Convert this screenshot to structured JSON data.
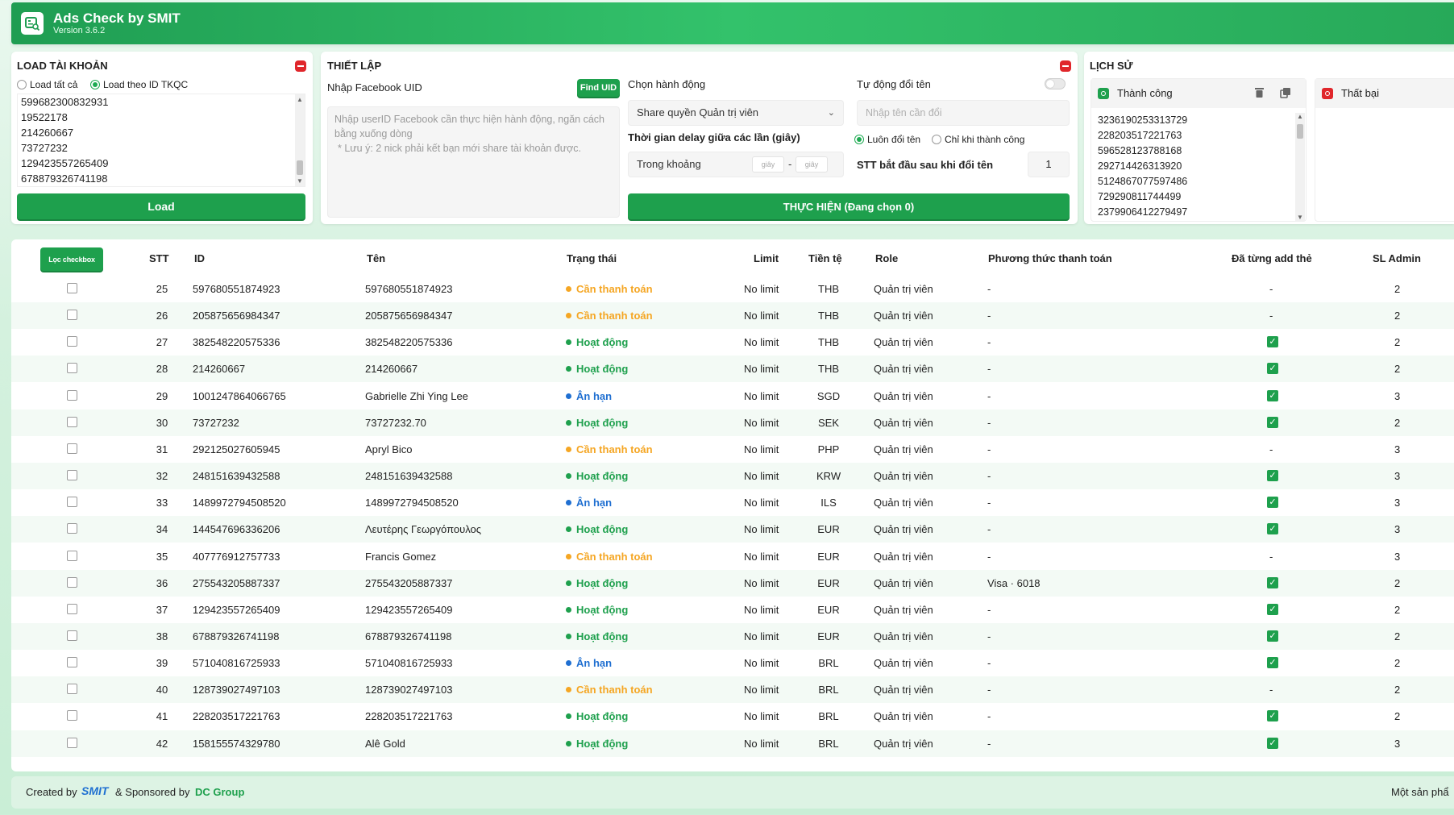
{
  "app": {
    "title": "Ads Check by SMIT",
    "version": "Version 3.6.2"
  },
  "load_panel": {
    "title": "LOAD TÀI KHOẢN",
    "radio_all": "Load tất cả",
    "radio_id": "Load theo ID TKQC",
    "ids": [
      "599682300832931",
      "19522178",
      "214260667",
      "73727232",
      "129423557265409",
      "678879326741198"
    ],
    "load_button": "Load"
  },
  "setup_panel": {
    "title": "THIẾT LẬP",
    "uid_label": "Nhập Facebook UID",
    "find_uid_button": "Find UID",
    "uid_placeholder": "Nhập userID Facebook cần thực hiện hành động, ngăn cách bằng xuống dòng",
    "uid_note": "* Lưu ý: 2 nick phải kết bạn mới share tài khoản được.",
    "action_label": "Chọn hành động",
    "action_value": "Share quyền Quản trị viên",
    "delay_label": "Thời gian delay giữa các lần (giây)",
    "delay_prefix": "Trong khoảng",
    "delay_from_placeholder": "giây",
    "delay_to_placeholder": "giây",
    "delay_dash": "-",
    "rename_label": "Tự động đổi tên",
    "rename_placeholder": "Nhập tên cần đổi",
    "rename_always": "Luôn đổi tên",
    "rename_success_only": "Chỉ khi thành công",
    "stt_label": "STT bắt đầu sau khi đổi tên",
    "stt_value": "1",
    "execute_button": "THỰC HIỆN (Đang chọn 0)"
  },
  "history_panel": {
    "title": "LỊCH SỬ",
    "success_label": "Thành công",
    "failed_label": "Thất bại",
    "success_ids": [
      "3236190253313729",
      "228203517221763",
      "596528123788168",
      "292714426313920",
      "5124867077597486",
      "729290811744499",
      "2379906412279497"
    ]
  },
  "table": {
    "filter_button": "Lọc checkbox",
    "headers": {
      "stt": "STT",
      "id": "ID",
      "name": "Tên",
      "status": "Trạng thái",
      "limit": "Limit",
      "currency": "Tiền tệ",
      "role": "Role",
      "payment": "Phương thức thanh toán",
      "card": "Đã từng add thẻ",
      "admins": "SL Admin"
    },
    "rows": [
      {
        "stt": "25",
        "id": "597680551874923",
        "name": "597680551874923",
        "status": "Cần thanh toán",
        "status_type": "warn",
        "limit": "No limit",
        "currency": "THB",
        "role": "Quản trị viên",
        "payment": "-",
        "card": "-",
        "admins": "2"
      },
      {
        "stt": "26",
        "id": "205875656984347",
        "name": "205875656984347",
        "status": "Cần thanh toán",
        "status_type": "warn",
        "limit": "No limit",
        "currency": "THB",
        "role": "Quản trị viên",
        "payment": "-",
        "card": "-",
        "admins": "2"
      },
      {
        "stt": "27",
        "id": "382548220575336",
        "name": "382548220575336",
        "status": "Hoạt động",
        "status_type": "ok",
        "limit": "No limit",
        "currency": "THB",
        "role": "Quản trị viên",
        "payment": "-",
        "card": "check",
        "admins": "2"
      },
      {
        "stt": "28",
        "id": "214260667",
        "name": "214260667",
        "status": "Hoạt động",
        "status_type": "ok",
        "limit": "No limit",
        "currency": "THB",
        "role": "Quản trị viên",
        "payment": "-",
        "card": "check",
        "admins": "2"
      },
      {
        "stt": "29",
        "id": "1001247864066765",
        "name": "Gabrielle Zhi Ying Lee",
        "status": "Ân hạn",
        "status_type": "grace",
        "limit": "No limit",
        "currency": "SGD",
        "role": "Quản trị viên",
        "payment": "-",
        "card": "check",
        "admins": "3"
      },
      {
        "stt": "30",
        "id": "73727232",
        "name": "73727232.70",
        "status": "Hoạt động",
        "status_type": "ok",
        "limit": "No limit",
        "currency": "SEK",
        "role": "Quản trị viên",
        "payment": "-",
        "card": "check",
        "admins": "2"
      },
      {
        "stt": "31",
        "id": "292125027605945",
        "name": "Apryl Bico",
        "status": "Cần thanh toán",
        "status_type": "warn",
        "limit": "No limit",
        "currency": "PHP",
        "role": "Quản trị viên",
        "payment": "-",
        "card": "-",
        "admins": "3"
      },
      {
        "stt": "32",
        "id": "248151639432588",
        "name": "248151639432588",
        "status": "Hoạt động",
        "status_type": "ok",
        "limit": "No limit",
        "currency": "KRW",
        "role": "Quản trị viên",
        "payment": "-",
        "card": "check",
        "admins": "3"
      },
      {
        "stt": "33",
        "id": "1489972794508520",
        "name": "1489972794508520",
        "status": "Ân hạn",
        "status_type": "grace",
        "limit": "No limit",
        "currency": "ILS",
        "role": "Quản trị viên",
        "payment": "-",
        "card": "check",
        "admins": "3"
      },
      {
        "stt": "34",
        "id": "144547696336206",
        "name": "Λευτέρης Γεωργόπουλος",
        "status": "Hoạt động",
        "status_type": "ok",
        "limit": "No limit",
        "currency": "EUR",
        "role": "Quản trị viên",
        "payment": "-",
        "card": "check",
        "admins": "3"
      },
      {
        "stt": "35",
        "id": "407776912757733",
        "name": "Francis Gomez",
        "status": "Cần thanh toán",
        "status_type": "warn",
        "limit": "No limit",
        "currency": "EUR",
        "role": "Quản trị viên",
        "payment": "-",
        "card": "-",
        "admins": "3"
      },
      {
        "stt": "36",
        "id": "275543205887337",
        "name": "275543205887337",
        "status": "Hoạt động",
        "status_type": "ok",
        "limit": "No limit",
        "currency": "EUR",
        "role": "Quản trị viên",
        "payment": "Visa · 6018",
        "card": "check",
        "admins": "2"
      },
      {
        "stt": "37",
        "id": "129423557265409",
        "name": "129423557265409",
        "status": "Hoạt động",
        "status_type": "ok",
        "limit": "No limit",
        "currency": "EUR",
        "role": "Quản trị viên",
        "payment": "-",
        "card": "check",
        "admins": "2"
      },
      {
        "stt": "38",
        "id": "678879326741198",
        "name": "678879326741198",
        "status": "Hoạt động",
        "status_type": "ok",
        "limit": "No limit",
        "currency": "EUR",
        "role": "Quản trị viên",
        "payment": "-",
        "card": "check",
        "admins": "2"
      },
      {
        "stt": "39",
        "id": "571040816725933",
        "name": "571040816725933",
        "status": "Ân hạn",
        "status_type": "grace",
        "limit": "No limit",
        "currency": "BRL",
        "role": "Quản trị viên",
        "payment": "-",
        "card": "check",
        "admins": "2"
      },
      {
        "stt": "40",
        "id": "128739027497103",
        "name": "128739027497103",
        "status": "Cần thanh toán",
        "status_type": "warn",
        "limit": "No limit",
        "currency": "BRL",
        "role": "Quản trị viên",
        "payment": "-",
        "card": "-",
        "admins": "2"
      },
      {
        "stt": "41",
        "id": "228203517221763",
        "name": "228203517221763",
        "status": "Hoạt động",
        "status_type": "ok",
        "limit": "No limit",
        "currency": "BRL",
        "role": "Quản trị viên",
        "payment": "-",
        "card": "check",
        "admins": "2"
      },
      {
        "stt": "42",
        "id": "158155574329780",
        "name": "Alê Gold",
        "status": "Hoạt động",
        "status_type": "ok",
        "limit": "No limit",
        "currency": "BRL",
        "role": "Quản trị viên",
        "payment": "-",
        "card": "check",
        "admins": "3"
      }
    ]
  },
  "footer": {
    "created_by": "Created by",
    "smit": "SMIT",
    "sponsored_by": "& Sponsored by",
    "dc_group": "DC Group",
    "right_text": "Một sản phẩ"
  },
  "colors": {
    "accent": "#1ea04d",
    "warn": "#f5a623",
    "ok": "#1ea04d",
    "grace": "#1f6fd1",
    "danger": "#e0262b"
  }
}
